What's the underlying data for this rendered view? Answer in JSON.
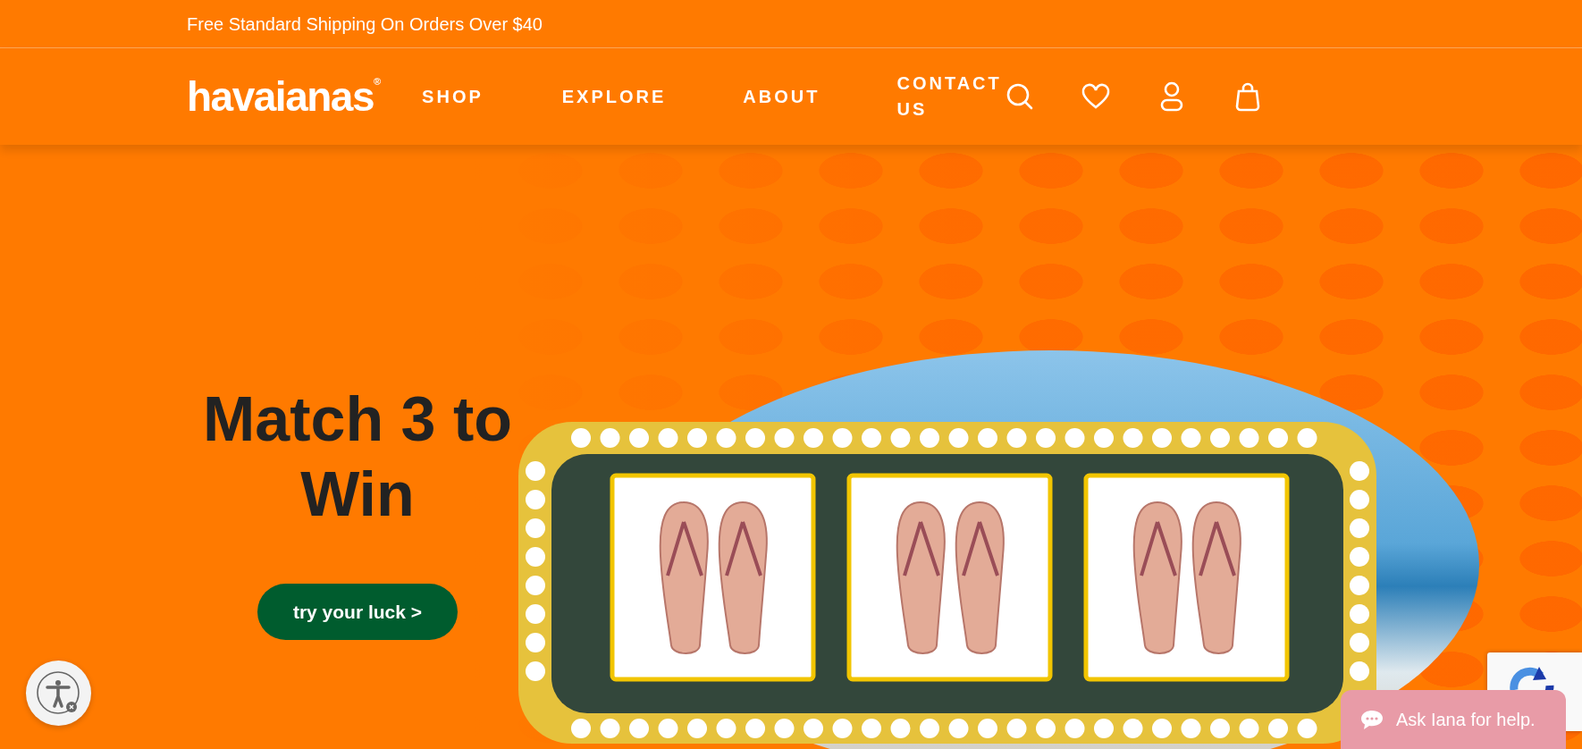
{
  "announcement": "Free Standard Shipping On Orders Over $40",
  "header": {
    "logo": "havaianas$^{®}$",
    "nav": [
      "SHOP",
      "EXPLORE",
      "ABOUT",
      "CONTACT US"
    ]
  },
  "hero": {
    "heading": "Match 3 to Win",
    "button": "try your luck >"
  },
  "chat": {
    "label": "Ask Iana for help."
  }
}
